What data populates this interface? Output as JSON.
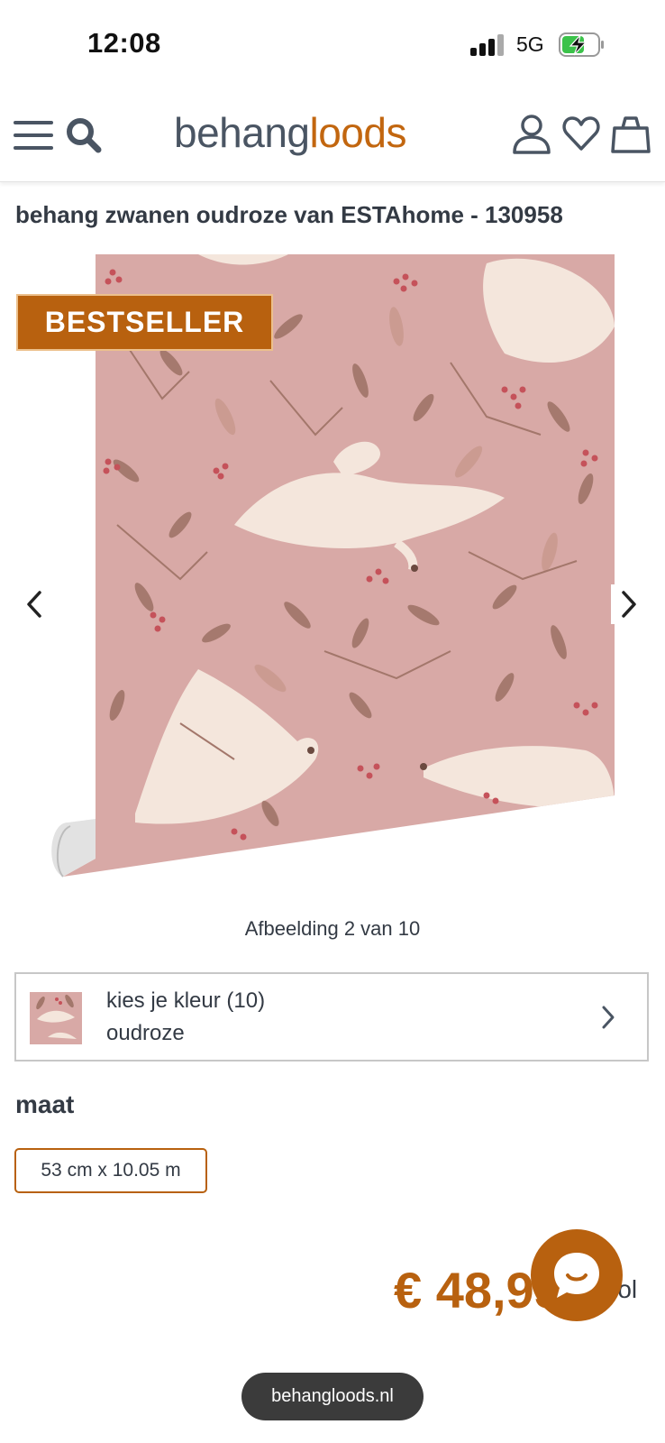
{
  "status_bar": {
    "time": "12:08",
    "network": "5G"
  },
  "header": {
    "logo_part1": "behang",
    "logo_part2": "loods",
    "icons": [
      "menu-icon",
      "search-icon",
      "user-icon",
      "heart-icon",
      "bag-icon"
    ]
  },
  "product": {
    "title": "behang zwanen oudroze van ESTAhome - 130958",
    "badge": "BESTSELLER",
    "image_counter": "Afbeelding 2 van 10"
  },
  "color_picker": {
    "label": "kies je kleur (10)",
    "value": "oudroze"
  },
  "size": {
    "heading": "maat",
    "option": "53 cm x 10.05 m"
  },
  "price": {
    "amount": "€ 48,95",
    "unit": "rol"
  },
  "browser": {
    "url": "behangloods.nl"
  },
  "colors": {
    "accent": "#b8610f",
    "text": "#333a44",
    "wallpaper_bg": "#d8a9a6",
    "leaf": "#a3776b",
    "swan": "#f4e6dc",
    "berry": "#c5525a"
  }
}
